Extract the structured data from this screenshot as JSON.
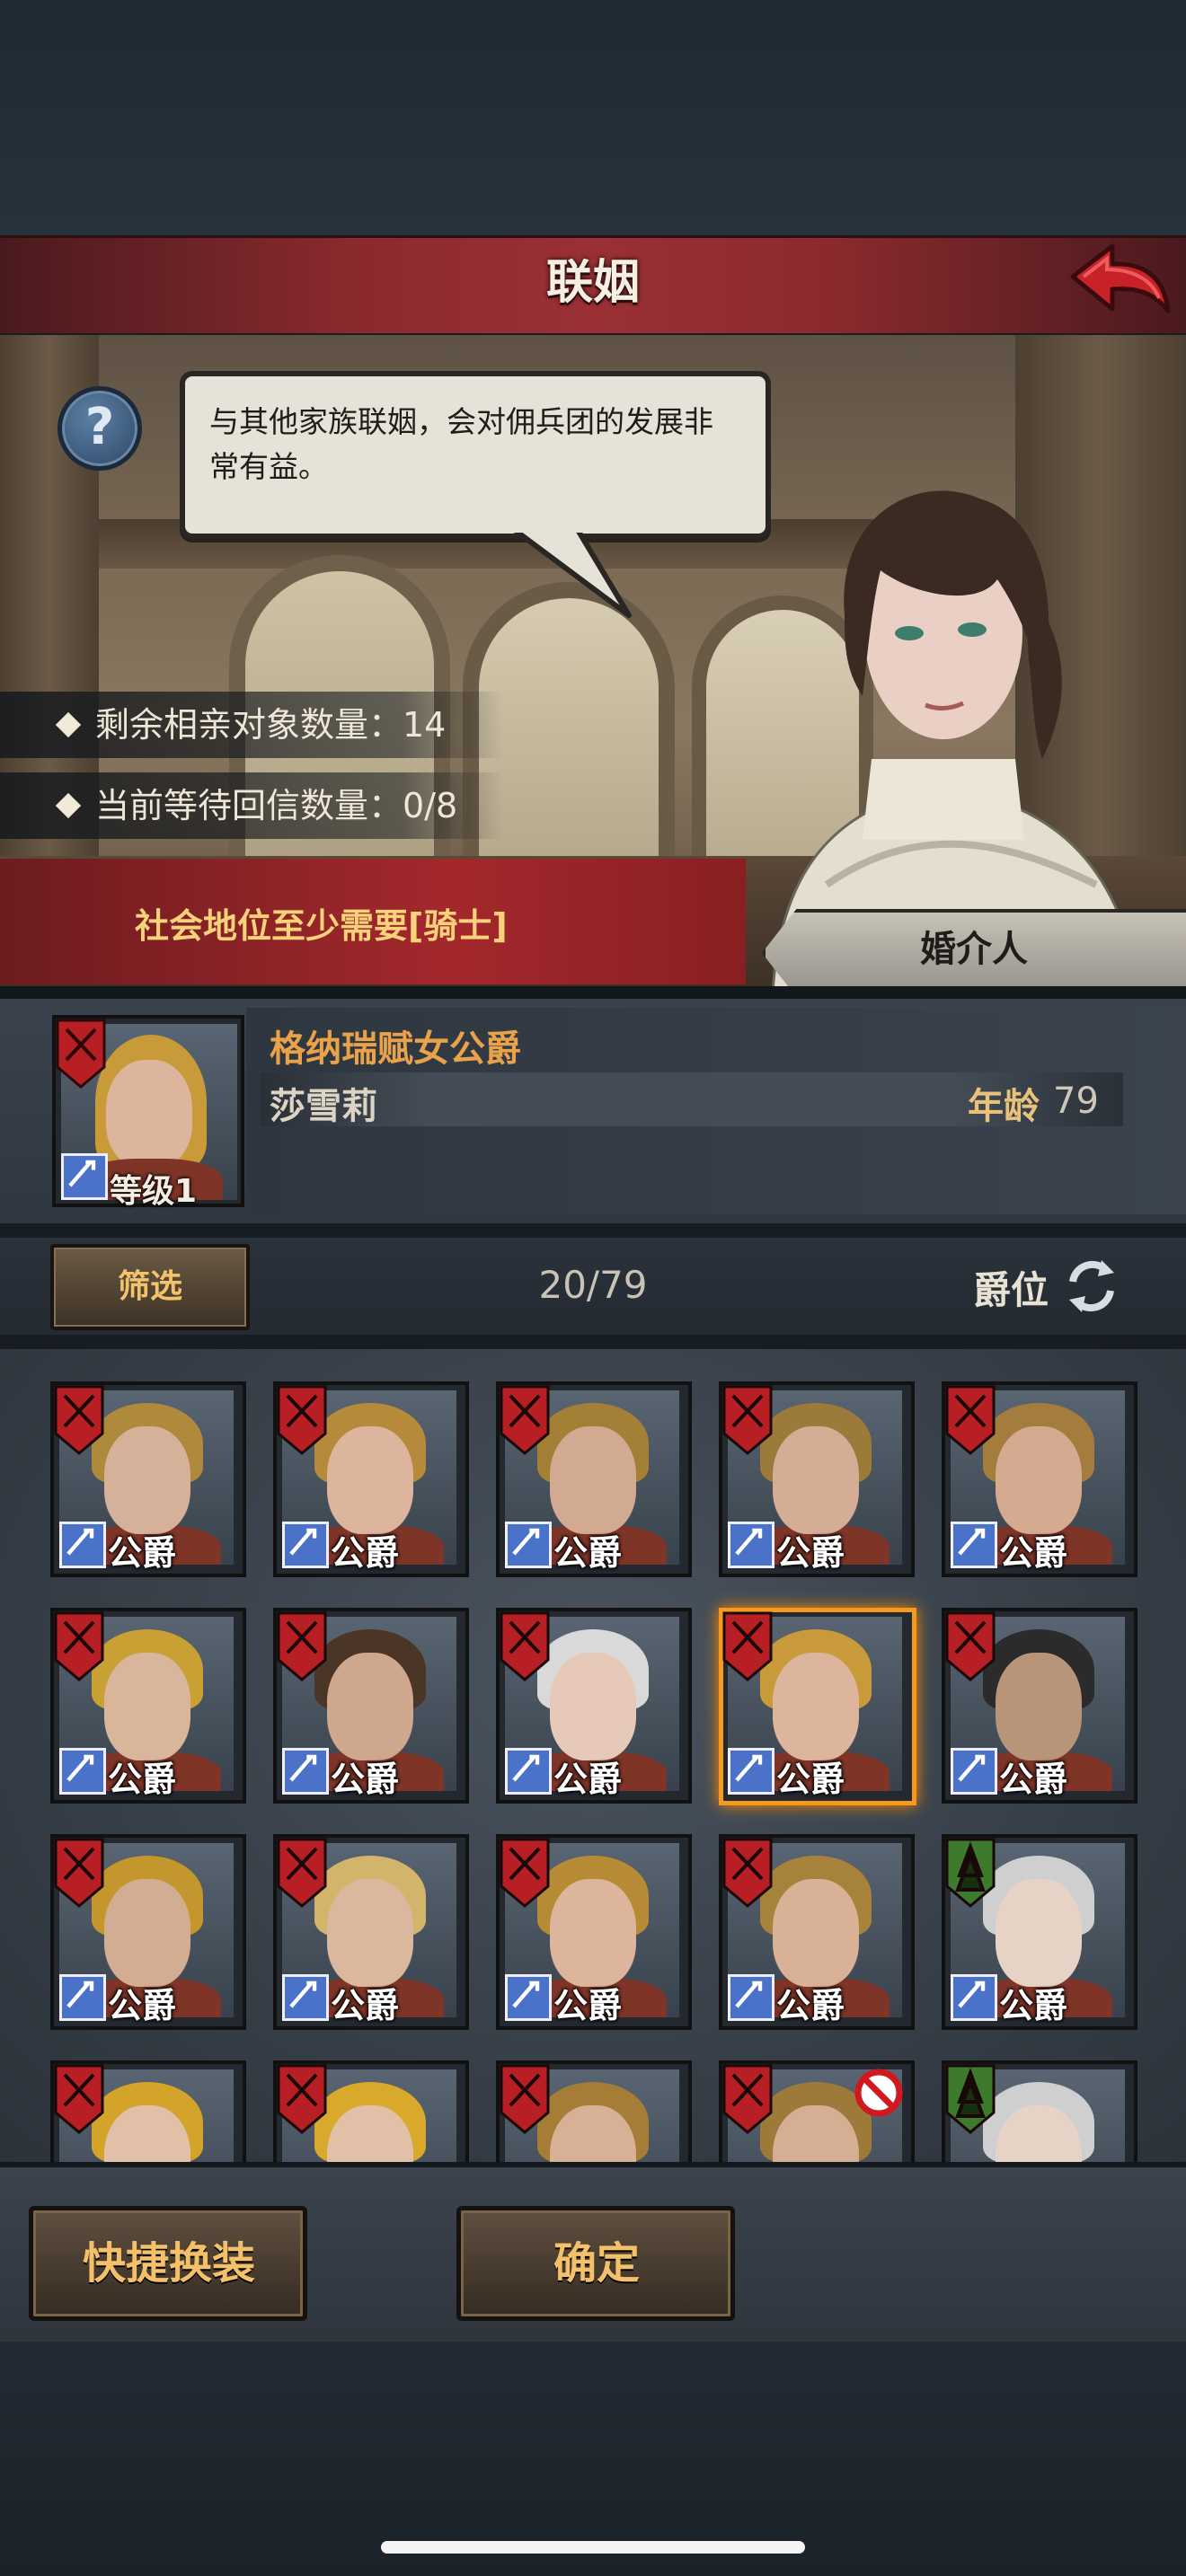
{
  "header": {
    "title": "联姻"
  },
  "intro": {
    "dialogue": "与其他家族联姻，会对佣兵团的发展非常有益。",
    "remaining_label": "剩余相亲对象数量：14",
    "waiting_label": "当前等待回信数量：0/8",
    "requirement": "社会地位至少需要[骑士]",
    "matchmaker_button": "婚介人"
  },
  "selected": {
    "title": "格纳瑞赋女公爵",
    "name": "莎雪莉",
    "age_label": "年龄",
    "age": "79",
    "level": "等级1"
  },
  "filter": {
    "button": "筛选",
    "count": "20/79",
    "sort_label": "爵位"
  },
  "grid": {
    "rank": "公爵",
    "rows": [
      [
        {
          "hair": "#b08a3c",
          "skin": "#d6b199",
          "crest": "red"
        },
        {
          "hair": "#b58a3a",
          "skin": "#dcb59c",
          "crest": "red"
        },
        {
          "hair": "#a47f36",
          "skin": "#d2aa92",
          "crest": "red"
        },
        {
          "hair": "#9c7a3a",
          "skin": "#d3ad94",
          "crest": "red"
        },
        {
          "hair": "#a47c3e",
          "skin": "#d4ab90",
          "crest": "red"
        }
      ],
      [
        {
          "hair": "#c9a033",
          "skin": "#d9b59b",
          "crest": "red"
        },
        {
          "hair": "#4a3526",
          "skin": "#cfa78d",
          "crest": "red"
        },
        {
          "hair": "#d9d9d9",
          "skin": "#e6c9b8",
          "crest": "red"
        },
        {
          "hair": "#c89a3a",
          "skin": "#dcb59c",
          "crest": "red",
          "selected": true
        },
        {
          "hair": "#2b2b2b",
          "skin": "#b89479",
          "crest": "red"
        }
      ],
      [
        {
          "hair": "#c4962e",
          "skin": "#d3ad92",
          "crest": "red"
        },
        {
          "hair": "#d2b56a",
          "skin": "#dbb79d",
          "crest": "red"
        },
        {
          "hair": "#b78b35",
          "skin": "#dcb59c",
          "crest": "red"
        },
        {
          "hair": "#a6823a",
          "skin": "#d8b197",
          "crest": "red"
        },
        {
          "hair": "#cfcfcf",
          "skin": "#e7d2c6",
          "crest": "green"
        }
      ],
      [
        {
          "hair": "#d4a32a",
          "skin": "#e2c0a8",
          "crest": "red"
        },
        {
          "hair": "#d9a92b",
          "skin": "#e2c0a8",
          "crest": "red"
        },
        {
          "hair": "#a57d36",
          "skin": "#d7b096",
          "crest": "red"
        },
        {
          "hair": "#9e7a3a",
          "skin": "#d5ae94",
          "crest": "red",
          "forbidden": true
        },
        {
          "hair": "#cfcfcf",
          "skin": "#e7d2c6",
          "crest": "green"
        }
      ]
    ]
  },
  "actions": {
    "quick_equip": "快捷换装",
    "confirm": "确定"
  },
  "colors": {
    "accent_orange": "#e9a24a",
    "title_red": "#9a3035",
    "button_gold": "#f4c06a",
    "selected_border": "#f59a1c"
  },
  "icons": [
    "back-arrow-icon",
    "help-icon",
    "refresh-icon",
    "sword-icon",
    "crest-icon",
    "forbidden-icon"
  ]
}
